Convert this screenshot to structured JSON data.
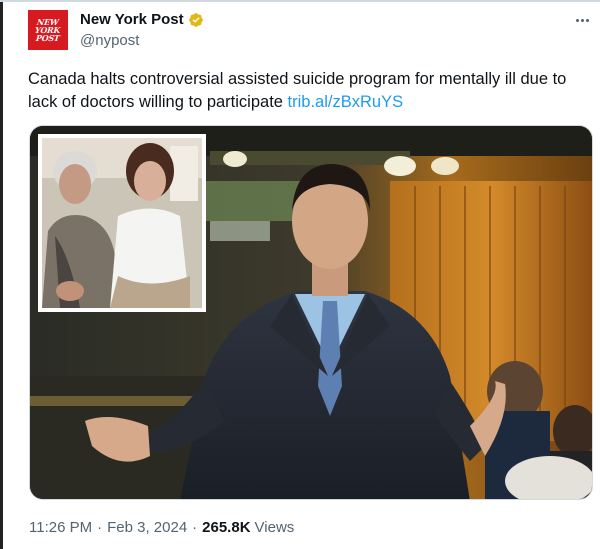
{
  "tweet": {
    "author": {
      "display_name": "New York Post",
      "handle": "@nypost",
      "avatar_lines": [
        "NEW",
        "YORK",
        "POST"
      ],
      "verified_color": "#e2b719"
    },
    "text": "Canada halts controversial assisted suicide program for mentally ill due to lack of doctors willing to participate",
    "link": "trib.al/zBxRuYS",
    "meta": {
      "time": "11:26 PM",
      "date": "Feb 3, 2024",
      "views_count": "265.8K",
      "views_label": "Views"
    }
  },
  "colors": {
    "link": "#1d9bf0",
    "secondary_text": "#536471",
    "brand_red": "#d71920"
  }
}
